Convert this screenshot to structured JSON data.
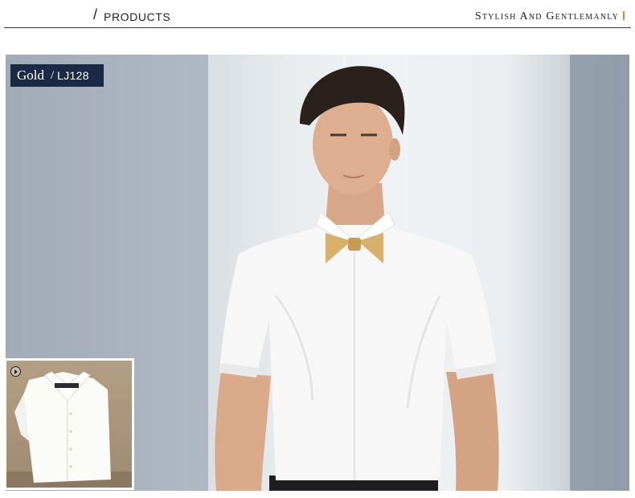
{
  "header": {
    "slash": "/",
    "section_title": "PRODUCTS",
    "tagline": "Stylish And Gentlemanly"
  },
  "product": {
    "color_name": "Gold",
    "code_separator": "/",
    "code": "LJ128"
  },
  "icons": {
    "thumbnail_badge": "play-circle-icon"
  },
  "colors": {
    "tag_background": "#1c2a48",
    "accent_bar": "#d08a3c",
    "bow_tie": "#d9b06a",
    "header_rule": "#3a3a3a"
  }
}
